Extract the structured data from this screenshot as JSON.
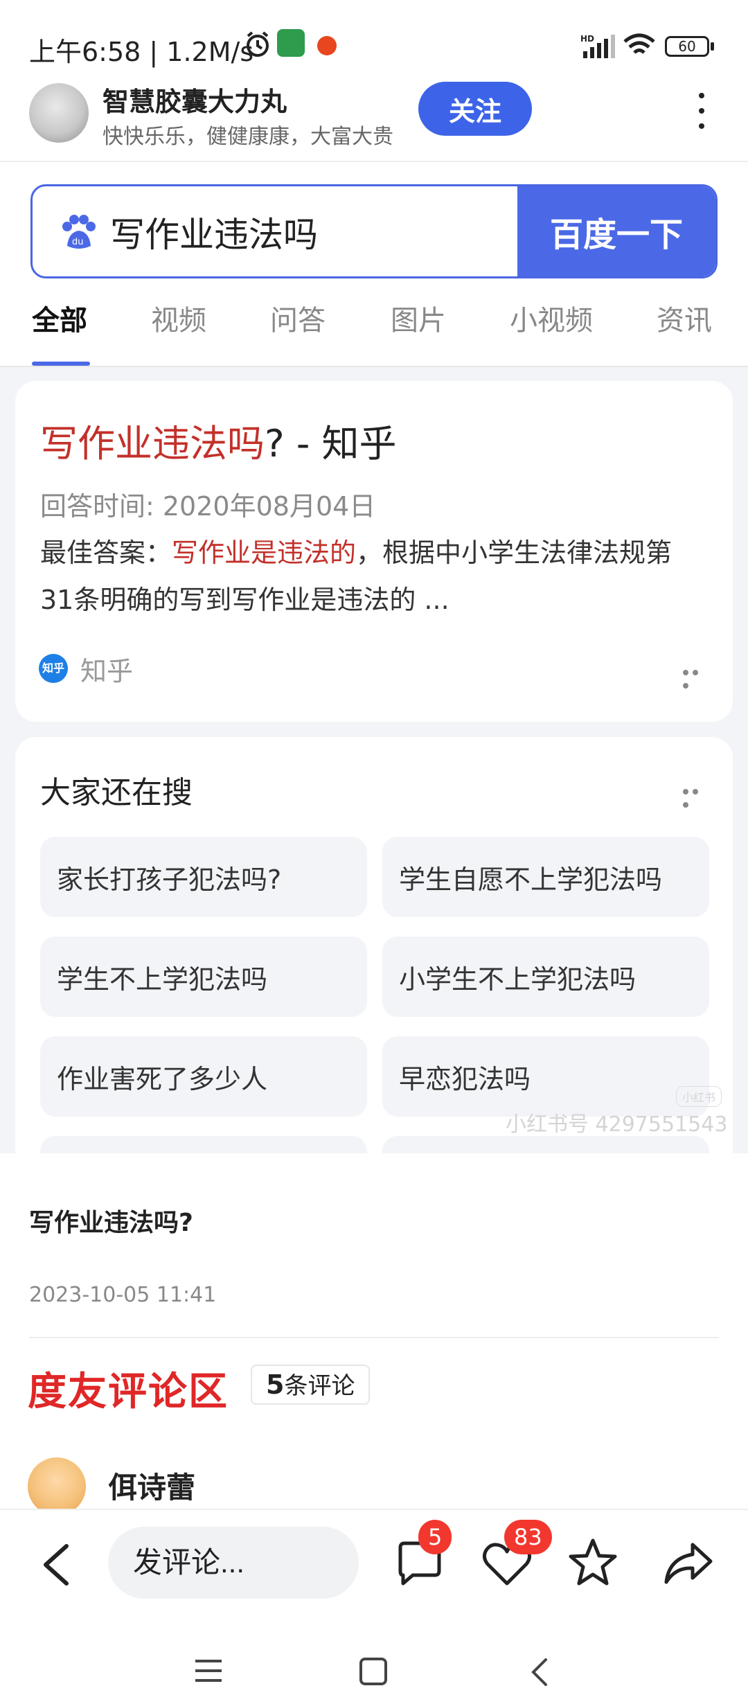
{
  "status_bar": {
    "time_speed": "上午6:58 | 1.2M/s",
    "battery": "60",
    "signal_label": "HD"
  },
  "author": {
    "name": "智慧胶囊大力丸",
    "bio": "快快乐乐，健健康康，大富大贵",
    "follow_label": "关注"
  },
  "search": {
    "query": "写作业违法吗",
    "button_label": "百度一下"
  },
  "tabs": [
    {
      "label": "全部",
      "active": true
    },
    {
      "label": "视频"
    },
    {
      "label": "问答"
    },
    {
      "label": "图片"
    },
    {
      "label": "小视频"
    },
    {
      "label": "资讯"
    }
  ],
  "result": {
    "title_highlight": "写作业违法吗",
    "title_rest": "? - 知乎",
    "meta": "回答时间: 2020年08月04日",
    "desc_prefix": "最佳答案：",
    "desc_highlight": "写作业是违法的",
    "desc_rest": "，根据中小学生法律法规第31条明确的写到写作业是违法的 ...",
    "source_logo": "知乎",
    "source": "知乎"
  },
  "related": {
    "title": "大家还在搜",
    "items": [
      "家长打孩子犯法吗?",
      "学生自愿不上学犯法吗",
      "学生不上学犯法吗",
      "小学生不上学犯法吗",
      "作业害死了多少人",
      "早恋犯法吗"
    ]
  },
  "watermark": {
    "logo": "小红书",
    "text": "小红书号 4297551543"
  },
  "post": {
    "title": "写作业违法吗?",
    "date": "2023-10-05 11:41"
  },
  "comments": {
    "title": "度友评论区",
    "count_num": "5",
    "count_suffix": "条评论",
    "first_user": "佴诗蕾"
  },
  "actionbar": {
    "comment_placeholder": "发评论...",
    "comment_badge": "5",
    "like_badge": "83"
  },
  "colors": {
    "accent": "#4b69e6",
    "highlight_red": "#c3302a",
    "comment_title_red": "#e02727",
    "badge_red": "#f2372e"
  }
}
